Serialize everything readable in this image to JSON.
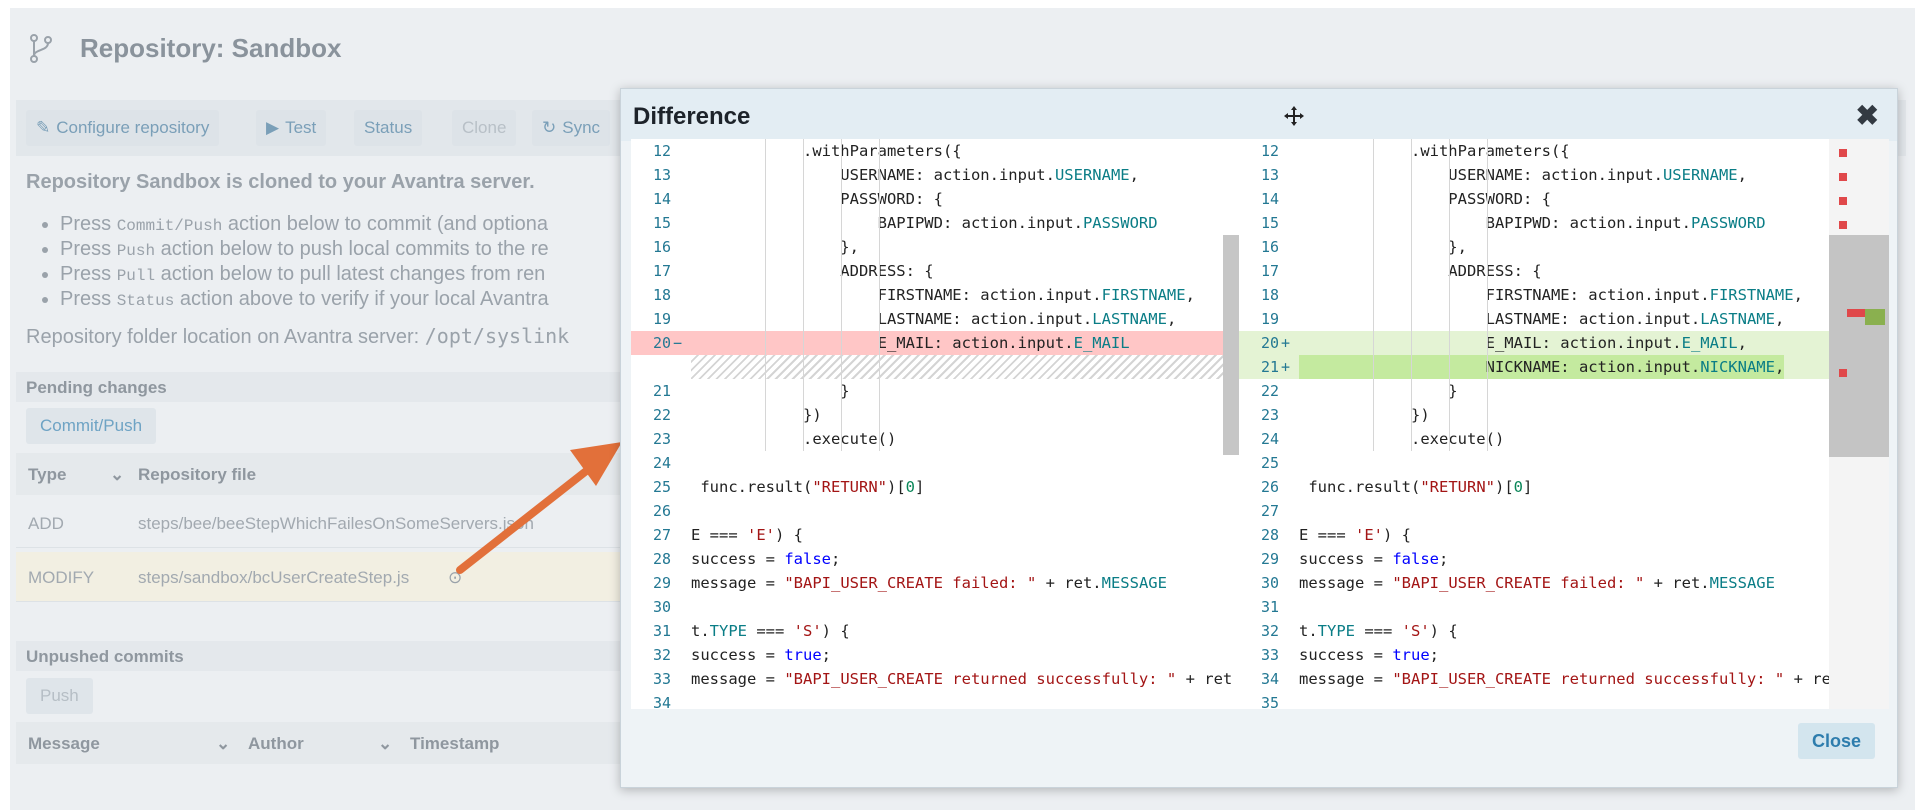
{
  "page": {
    "title": "Repository: Sandbox",
    "toolbar": {
      "configure": "Configure repository",
      "test": "Test",
      "status": "Status",
      "clone": "Clone",
      "sync": "Sync"
    },
    "info_heading": "Repository Sandbox is cloned to your Avantra server.",
    "bullets": [
      {
        "pre": "Press ",
        "code": "Commit/Push",
        "post": " action below to commit (and optiona"
      },
      {
        "pre": "Press ",
        "code": "Push",
        "post": " action below to push local commits to the re"
      },
      {
        "pre": "Press ",
        "code": "Pull",
        "post": " action below to pull latest changes from ren"
      },
      {
        "pre": "Press ",
        "code": "Status",
        "post": " action above to verify if your local Avantra"
      }
    ],
    "location_label": "Repository folder location on Avantra server: ",
    "location_path": "/opt/syslink",
    "pending": {
      "title": "Pending changes",
      "button": "Commit/Push",
      "columns": {
        "type": "Type",
        "file": "Repository file"
      },
      "rows": [
        {
          "type": "ADD",
          "file": "steps/bee/beeStepWhichFailesOnSomeServers.json"
        },
        {
          "type": "MODIFY",
          "file": "steps/sandbox/bcUserCreateStep.js"
        }
      ]
    },
    "unpushed": {
      "title": "Unpushed commits",
      "button": "Push",
      "columns": {
        "message": "Message",
        "author": "Author",
        "timestamp": "Timestamp"
      }
    }
  },
  "modal": {
    "title": "Difference",
    "close_button": "Close",
    "left_lines": [
      {
        "n": "12",
        "m": "",
        "t": "",
        "code": "            .withParameters({"
      },
      {
        "n": "13",
        "m": "",
        "t": "",
        "code": "                USERNAME: action.input.USERNAME,"
      },
      {
        "n": "14",
        "m": "",
        "t": "",
        "code": "                PASSWORD: {"
      },
      {
        "n": "15",
        "m": "",
        "t": "",
        "code": "                    BAPIPWD: action.input.PASSWORD"
      },
      {
        "n": "16",
        "m": "",
        "t": "",
        "code": "                },"
      },
      {
        "n": "17",
        "m": "",
        "t": "",
        "code": "                ADDRESS: {"
      },
      {
        "n": "18",
        "m": "",
        "t": "",
        "code": "                    FIRSTNAME: action.input.FIRSTNAME,"
      },
      {
        "n": "19",
        "m": "",
        "t": "",
        "code": "                    LASTNAME: action.input.LASTNAME,"
      },
      {
        "n": "20",
        "m": "−",
        "t": "del",
        "code": "                    E_MAIL: action.input.E_MAIL"
      },
      {
        "n": "",
        "m": "",
        "t": "hatch",
        "code": ""
      },
      {
        "n": "21",
        "m": "",
        "t": "",
        "code": "                }"
      },
      {
        "n": "22",
        "m": "",
        "t": "",
        "code": "            })"
      },
      {
        "n": "23",
        "m": "",
        "t": "",
        "code": "            .execute()"
      },
      {
        "n": "24",
        "m": "",
        "t": "",
        "code": ""
      },
      {
        "n": "25",
        "m": "",
        "t": "",
        "code": " func.result(\"RETURN\")[0]"
      },
      {
        "n": "26",
        "m": "",
        "t": "",
        "code": ""
      },
      {
        "n": "27",
        "m": "",
        "t": "",
        "code": "E === 'E') {"
      },
      {
        "n": "28",
        "m": "",
        "t": "",
        "code": "success = false;"
      },
      {
        "n": "29",
        "m": "",
        "t": "",
        "code": "message = \"BAPI_USER_CREATE failed: \" + ret.MESSAGE"
      },
      {
        "n": "30",
        "m": "",
        "t": "",
        "code": ""
      },
      {
        "n": "31",
        "m": "",
        "t": "",
        "code": "t.TYPE === 'S') {"
      },
      {
        "n": "32",
        "m": "",
        "t": "",
        "code": "success = true;"
      },
      {
        "n": "33",
        "m": "",
        "t": "",
        "code": "message = \"BAPI_USER_CREATE returned successfully: \" + ret"
      },
      {
        "n": "34",
        "m": "",
        "t": "",
        "code": ""
      }
    ],
    "right_lines": [
      {
        "n": "12",
        "m": "",
        "t": "",
        "code": "            .withParameters({"
      },
      {
        "n": "13",
        "m": "",
        "t": "",
        "code": "                USERNAME: action.input.USERNAME,"
      },
      {
        "n": "14",
        "m": "",
        "t": "",
        "code": "                PASSWORD: {"
      },
      {
        "n": "15",
        "m": "",
        "t": "",
        "code": "                    BAPIPWD: action.input.PASSWORD"
      },
      {
        "n": "16",
        "m": "",
        "t": "",
        "code": "                },"
      },
      {
        "n": "17",
        "m": "",
        "t": "",
        "code": "                ADDRESS: {"
      },
      {
        "n": "18",
        "m": "",
        "t": "",
        "code": "                    FIRSTNAME: action.input.FIRSTNAME,"
      },
      {
        "n": "19",
        "m": "",
        "t": "",
        "code": "                    LASTNAME: action.input.LASTNAME,"
      },
      {
        "n": "20",
        "m": "+",
        "t": "add",
        "code": "                    E_MAIL: action.input.E_MAIL,"
      },
      {
        "n": "21",
        "m": "+",
        "t": "add",
        "code": "                    NICKNAME: action.input.NICKNAME,"
      },
      {
        "n": "22",
        "m": "",
        "t": "",
        "code": "                }"
      },
      {
        "n": "23",
        "m": "",
        "t": "",
        "code": "            })"
      },
      {
        "n": "24",
        "m": "",
        "t": "",
        "code": "            .execute()"
      },
      {
        "n": "25",
        "m": "",
        "t": "",
        "code": ""
      },
      {
        "n": "26",
        "m": "",
        "t": "",
        "code": " func.result(\"RETURN\")[0]"
      },
      {
        "n": "27",
        "m": "",
        "t": "",
        "code": ""
      },
      {
        "n": "28",
        "m": "",
        "t": "",
        "code": "E === 'E') {"
      },
      {
        "n": "29",
        "m": "",
        "t": "",
        "code": "success = false;"
      },
      {
        "n": "30",
        "m": "",
        "t": "",
        "code": "message = \"BAPI_USER_CREATE failed: \" + ret.MESSAGE"
      },
      {
        "n": "31",
        "m": "",
        "t": "",
        "code": ""
      },
      {
        "n": "32",
        "m": "",
        "t": "",
        "code": "t.TYPE === 'S') {"
      },
      {
        "n": "33",
        "m": "",
        "t": "",
        "code": "success = true;"
      },
      {
        "n": "34",
        "m": "",
        "t": "",
        "code": "message = \"BAPI_USER_CREATE returned successfully: \" + ret"
      },
      {
        "n": "35",
        "m": "",
        "t": "",
        "code": ""
      }
    ]
  },
  "colors": {
    "deleted_line": "#ffc6c6",
    "added_line": "#e4f3d4",
    "arrow": "#e2703a",
    "close_button": "#2e7dad"
  },
  "icons": {
    "repo": "git-branch-icon",
    "configure": "edit-icon",
    "test": "play-circle-icon",
    "sync": "sync-icon",
    "move": "move-icon",
    "close": "close-icon"
  }
}
